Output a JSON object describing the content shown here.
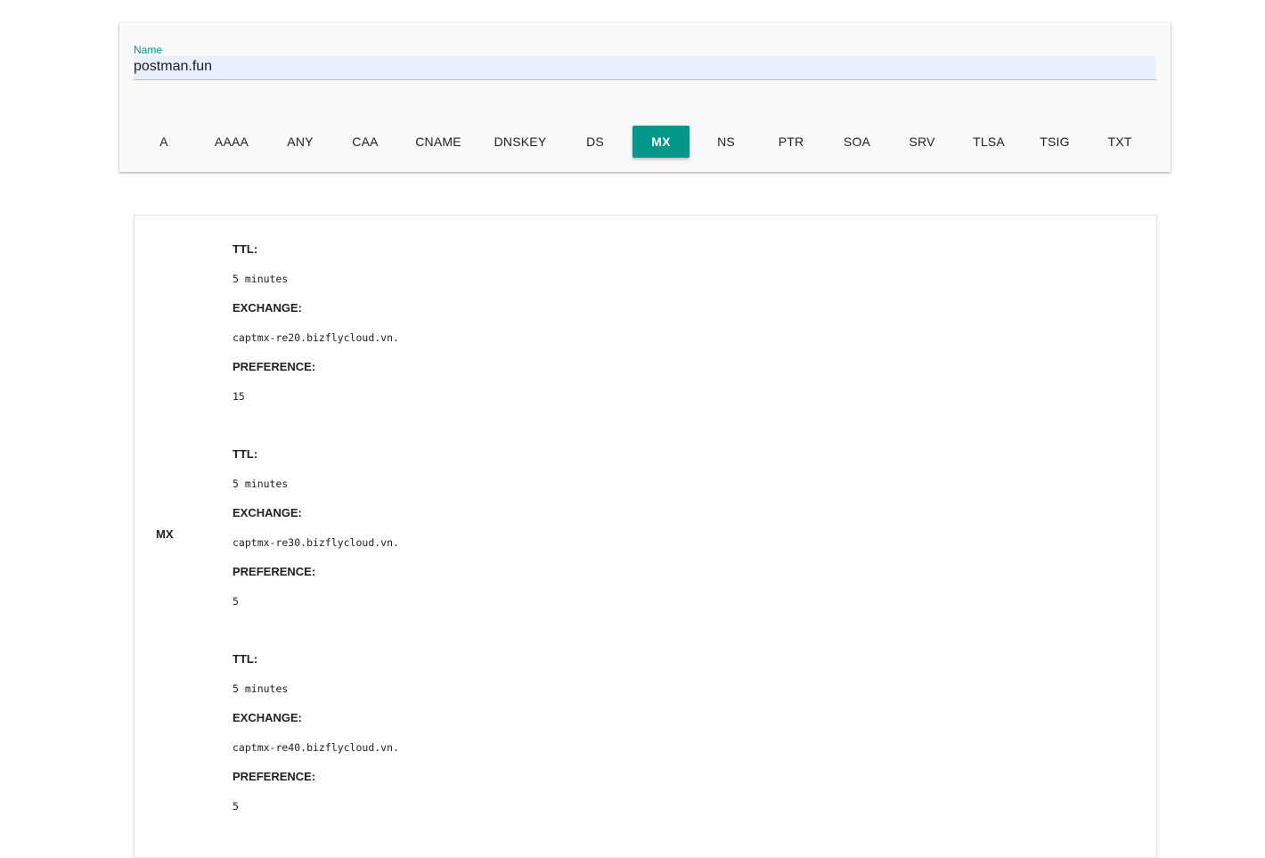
{
  "query": {
    "name_label": "Name",
    "name_value": "postman.fun"
  },
  "record_types": [
    "A",
    "AAAA",
    "ANY",
    "CAA",
    "CNAME",
    "DNSKEY",
    "DS",
    "MX",
    "NS",
    "PTR",
    "SOA",
    "SRV",
    "TLSA",
    "TSIG",
    "TXT"
  ],
  "selected_type": "MX",
  "accent_color": "#009688",
  "result": {
    "type": "MX",
    "labels": {
      "ttl": "TTL:",
      "exchange": "EXCHANGE:",
      "preference": "PREFERENCE:"
    },
    "records": [
      {
        "ttl": "5 minutes",
        "exchange": "captmx-re20.bizflycloud.vn.",
        "preference": "15"
      },
      {
        "ttl": "5 minutes",
        "exchange": "captmx-re30.bizflycloud.vn.",
        "preference": "5"
      },
      {
        "ttl": "5 minutes",
        "exchange": "captmx-re40.bizflycloud.vn.",
        "preference": "5"
      }
    ]
  }
}
